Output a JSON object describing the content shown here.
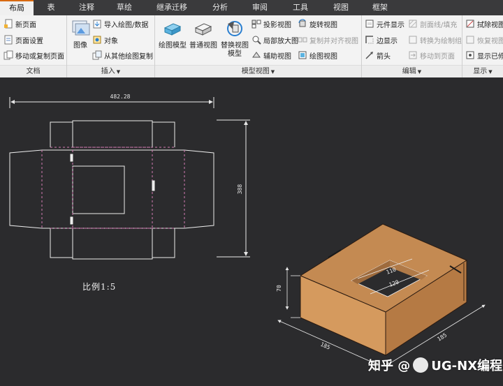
{
  "tabs": [
    {
      "label": "布局",
      "active": true
    },
    {
      "label": "表",
      "active": false
    },
    {
      "label": "注释",
      "active": false
    },
    {
      "label": "草绘",
      "active": false
    },
    {
      "label": "继承迁移",
      "active": false
    },
    {
      "label": "分析",
      "active": false
    },
    {
      "label": "审阅",
      "active": false
    },
    {
      "label": "工具",
      "active": false
    },
    {
      "label": "视图",
      "active": false
    },
    {
      "label": "框架",
      "active": false
    }
  ],
  "ribbon": {
    "document": {
      "label": "文档",
      "new_page": "新页面",
      "page_setup": "页面设置",
      "move_copy_page": "移动或复制页面"
    },
    "insert": {
      "label": "插入",
      "image": "图像",
      "import_drawing": "导入绘图/数据",
      "object": "对象",
      "copy_from_other": "从其他绘图复制"
    },
    "model_views": {
      "label": "模型视图",
      "drawing_model": "绘图模型",
      "general_view": "普通视图",
      "replace_view_line1": "替换视图",
      "replace_view_line2": "模型",
      "projection_view": "投影视图",
      "rotate_view": "旋转视图",
      "detail_view": "局部放大图",
      "copy_align_view": "复制并对齐视图",
      "auxiliary_view": "辅助视图",
      "drawing_view": "绘图视图"
    },
    "edit": {
      "label": "编辑",
      "component_display": "元件显示",
      "section_hatch": "剖面线/填充",
      "edge_display": "边显示",
      "convert_to_group": "转换为绘制组",
      "arrow": "箭头",
      "move_to_page": "移动到页面"
    },
    "display": {
      "label": "显示",
      "erase_view": "拭除视图",
      "restore_view": "恢复视图",
      "show_erased": "显示已修"
    }
  },
  "drawing": {
    "width_dim": "482.28",
    "height_dim": "388",
    "scale_text": "比例1:5",
    "iso_height_dim": "70",
    "iso_dim_opening_1": "110",
    "iso_dim_opening_2": "120",
    "iso_dim_left": "185",
    "iso_dim_right": "185",
    "box_color": "#c48a52"
  },
  "watermark": {
    "prefix": "知乎 @",
    "name": "UG-NX编程"
  }
}
